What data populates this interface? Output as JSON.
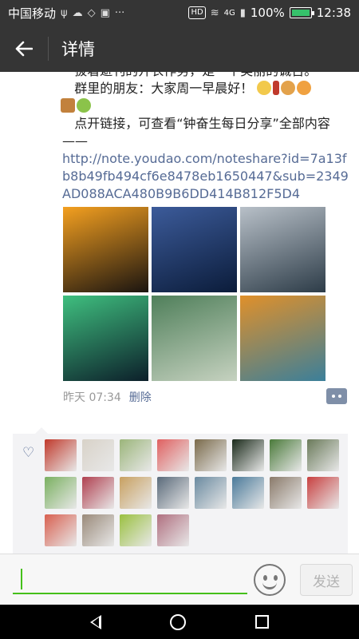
{
  "status_bar": {
    "carrier": "中国移动",
    "network": "4G",
    "battery": "100%",
    "time": "12:38"
  },
  "header": {
    "title": "详情"
  },
  "post": {
    "line0": "拔着避刊的开衣作务，是一个美丽的诚召。",
    "line1": "群里的朋友：大家周一早晨好！",
    "line2": "点开链接，可查看“钟奋生每日分享”全部内容——",
    "link": "http://note.youdao.com/noteshare?id=7a13fb8b49fb494cf6e8478eb1650447&sub=2349AD088ACA480B9B6DD414B812F5D4",
    "photos": [
      {
        "name": "sunset-crane",
        "colors": [
          "#f4a020",
          "#1a1410"
        ]
      },
      {
        "name": "tower-bridge-night",
        "colors": [
          "#3c5b9a",
          "#0b1c3a"
        ]
      },
      {
        "name": "misty-islands",
        "colors": [
          "#b8c0c8",
          "#2d3c48"
        ]
      },
      {
        "name": "aurora-snow",
        "colors": [
          "#3fbf7f",
          "#0c1f2a"
        ]
      },
      {
        "name": "stone-arch-bridge",
        "colors": [
          "#4f7f5a",
          "#c6d2c0"
        ]
      },
      {
        "name": "autumn-river",
        "colors": [
          "#e0902a",
          "#3b7f9a"
        ]
      }
    ],
    "time": "昨天 07:34",
    "delete": "删除"
  },
  "likes": {
    "avatars": [
      "#c0392b",
      "#d8d2c8",
      "#9bb57a",
      "#e06060",
      "#7a6a4a",
      "#1a2a1a",
      "#4a7a3a",
      "#6a7a5a",
      "#7ab060",
      "#b04050",
      "#c8a060",
      "#5a6a7a",
      "#6a8aa0",
      "#4a7a9a",
      "#8a7a6a",
      "#c84040",
      "#d86050",
      "#9a8a7a",
      "#9ac040",
      "#b07080"
    ]
  },
  "input_bar": {
    "send": "发送"
  }
}
